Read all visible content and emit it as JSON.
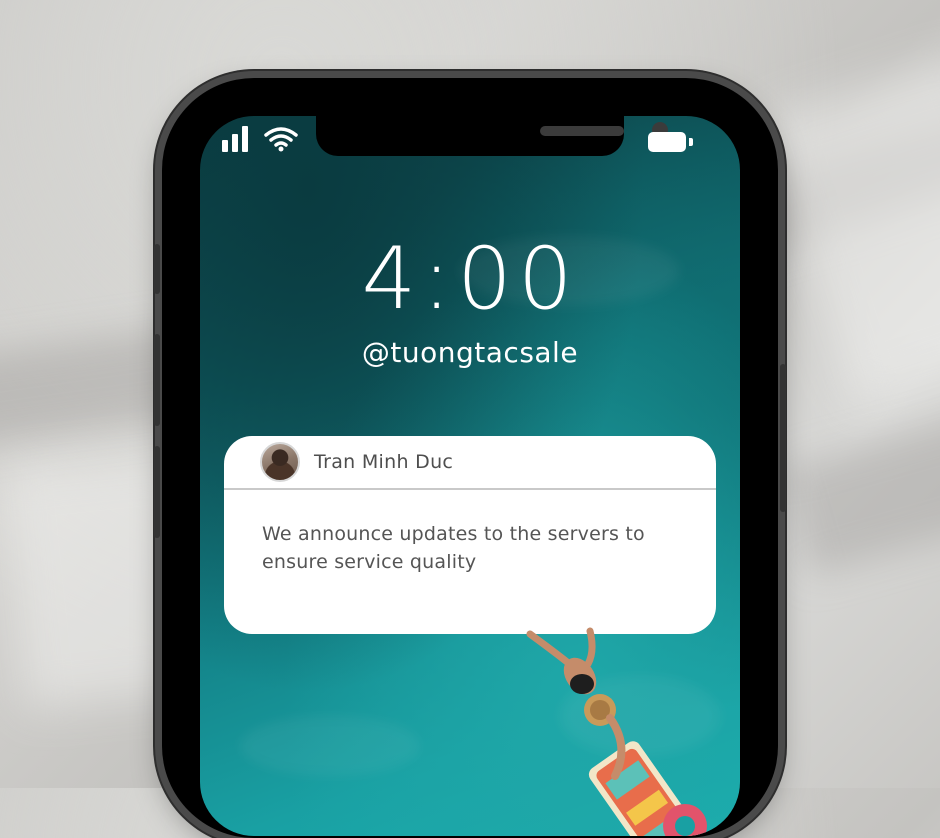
{
  "lockscreen": {
    "time": "4:00",
    "handle": "@tuongtacsale"
  },
  "status_bar": {
    "signal_icon": "signal-bars-icon",
    "wifi_icon": "wifi-icon",
    "battery_icon": "battery-icon",
    "battery_level": 1.0
  },
  "notification": {
    "sender": "Tran Minh Duc",
    "avatar": "avatar",
    "message": "We announce updates to the servers to ensure service quality"
  },
  "colors": {
    "screen_dark": "#0c3c41",
    "screen_light": "#1bb0b0",
    "notification_bg": "#ffffff",
    "text_gray": "#555555"
  }
}
